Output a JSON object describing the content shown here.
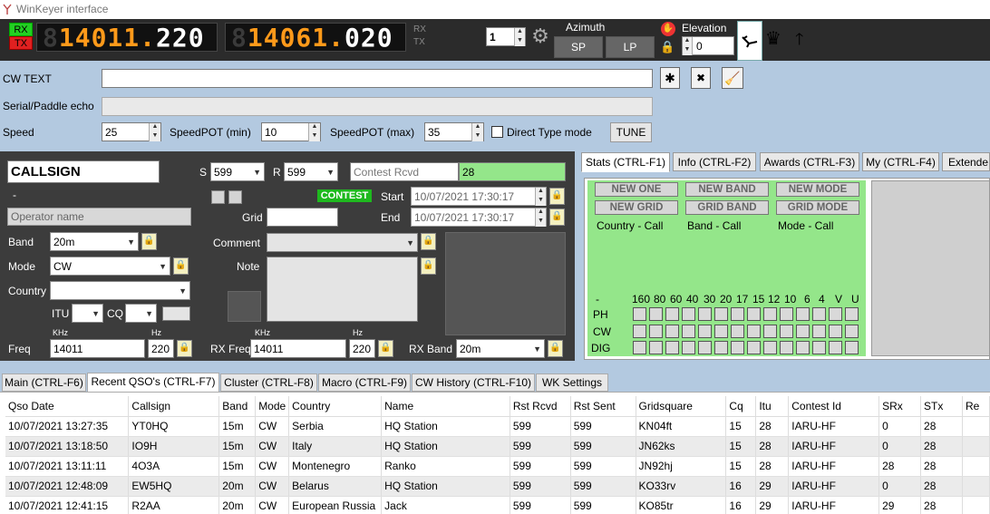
{
  "window": {
    "title": "WinKeyer interface"
  },
  "topbar": {
    "rx_label": "RX",
    "tx_label": "TX",
    "freq1_dim": "8",
    "freq1": "1401",
    "freq1_sep": "1.",
    "freq1_rest": "220",
    "freq2_dim": "8",
    "freq2": "1406",
    "freq2_sep": "1.",
    "freq2_rest": "020",
    "rx_small": "RX",
    "tx_small": "TX",
    "step_value": "1",
    "azimuth_label": "Azimuth",
    "sp_button": "SP",
    "lp_button": "LP",
    "elevation_label": "Elevation",
    "elevation_value": "0"
  },
  "form": {
    "cw_text_label": "CW TEXT",
    "cw_text_value": "",
    "serial_label": "Serial/Paddle echo",
    "speed_label": "Speed",
    "speed_value": "25",
    "speedpot_min_label": "SpeedPOT (min)",
    "speedpot_min_value": "10",
    "speedpot_max_label": "SpeedPOT (max)",
    "speedpot_max_value": "35",
    "direct_type_label": "Direct Type mode",
    "tune_button": "TUNE"
  },
  "qso": {
    "callsign": "CALLSIGN",
    "dash": "-",
    "s_label": "S",
    "s_value": "599",
    "r_label": "R",
    "r_value": "599",
    "contest_rcvd_placeholder": "Contest Rcvd",
    "contest_rcvd_value": "28",
    "contest_badge": "CONTEST",
    "start_label": "Start",
    "start_value": "10/07/2021 17:30:17",
    "end_label": "End",
    "end_value": "10/07/2021 17:30:17",
    "operator_placeholder": "Operator name",
    "grid_label": "Grid",
    "band_label": "Band",
    "band_value": "20m",
    "comment_label": "Comment",
    "mode_label": "Mode",
    "mode_value": "CW",
    "note_label": "Note",
    "country_label": "Country",
    "itu_label": "ITU",
    "cq_label": "CQ",
    "khz_label": "KHz",
    "hz_label": "Hz",
    "freq_label": "Freq",
    "freq_khz": "14011",
    "freq_hz": "220",
    "rx_freq_label": "RX Freq",
    "rx_freq_khz": "14011",
    "rx_freq_hz": "220",
    "rx_band_label": "RX Band",
    "rx_band_value": "20m"
  },
  "stats": {
    "tabs": [
      "Stats (CTRL-F1)",
      "Info (CTRL-F2)",
      "Awards (CTRL-F3)",
      "My (CTRL-F4)",
      "Extende"
    ],
    "badges": [
      "NEW ONE",
      "NEW BAND",
      "NEW MODE",
      "NEW GRID",
      "GRID BAND",
      "GRID MODE"
    ],
    "captions": [
      "Country - Call",
      "Band - Call",
      "Mode - Call"
    ],
    "bands": [
      "-",
      "160",
      "80",
      "60",
      "40",
      "30",
      "20",
      "17",
      "15",
      "12",
      "10",
      "6",
      "4",
      "V",
      "U"
    ],
    "modes": [
      "PH",
      "CW",
      "DIG"
    ]
  },
  "bottom_tabs": [
    "Main (CTRL-F6)",
    "Recent QSO's (CTRL-F7)",
    "Cluster (CTRL-F8)",
    "Macro (CTRL-F9)",
    "CW History (CTRL-F10)",
    "WK Settings"
  ],
  "table": {
    "headers": [
      "Qso Date",
      "Callsign",
      "Band",
      "Mode",
      "Country",
      "Name",
      "Rst Rcvd",
      "Rst Sent",
      "Gridsquare",
      "Cq",
      "Itu",
      "Contest Id",
      "SRx",
      "STx",
      "Re"
    ],
    "rows": [
      [
        "10/07/2021 13:27:35",
        "YT0HQ",
        "15m",
        "CW",
        "Serbia",
        "HQ Station",
        "599",
        "599",
        "KN04ft",
        "15",
        "28",
        "IARU-HF",
        "0",
        "28",
        ""
      ],
      [
        "10/07/2021 13:18:50",
        "IO9H",
        "15m",
        "CW",
        "Italy",
        "HQ Station",
        "599",
        "599",
        "JN62ks",
        "15",
        "28",
        "IARU-HF",
        "0",
        "28",
        ""
      ],
      [
        "10/07/2021 13:11:11",
        "4O3A",
        "15m",
        "CW",
        "Montenegro",
        "Ranko",
        "599",
        "599",
        "JN92hj",
        "15",
        "28",
        "IARU-HF",
        "28",
        "28",
        ""
      ],
      [
        "10/07/2021 12:48:09",
        "EW5HQ",
        "20m",
        "CW",
        "Belarus",
        "HQ Station",
        "599",
        "599",
        "KO33rv",
        "16",
        "29",
        "IARU-HF",
        "0",
        "28",
        ""
      ],
      [
        "10/07/2021 12:41:15",
        "R2AA",
        "20m",
        "CW",
        "European Russia",
        "Jack",
        "599",
        "599",
        "KO85tr",
        "16",
        "29",
        "IARU-HF",
        "29",
        "28",
        ""
      ]
    ]
  }
}
